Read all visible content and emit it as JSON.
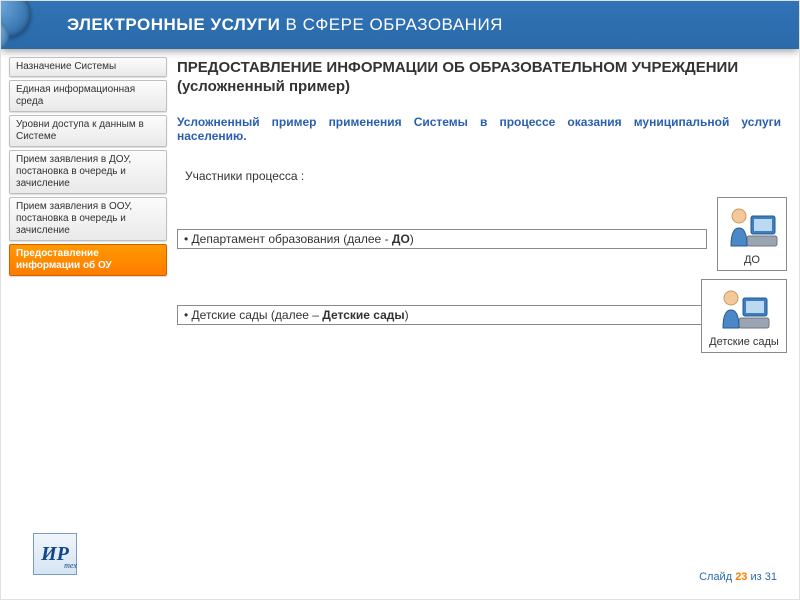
{
  "header": {
    "title_strong": "ЭЛЕКТРОННЫЕ УСЛУГИ",
    "title_rest": " В СФЕРЕ ОБРАЗОВАНИЯ"
  },
  "sidebar": {
    "items": [
      {
        "label": "Назначение Системы"
      },
      {
        "label": "Единая информационная среда"
      },
      {
        "label": "Уровни доступа к данным в Системе"
      },
      {
        "label": "Прием заявления в ДОУ, постановка в очередь и зачисление"
      },
      {
        "label": "Прием заявления в ООУ, постановка в очередь и зачисление"
      },
      {
        "label": "Предоставление информации об ОУ"
      }
    ]
  },
  "main": {
    "title": "ПРЕДОСТАВЛЕНИЕ ИНФОРМАЦИИ ОБ ОБРАЗОВАТЕЛЬНОМ УЧРЕЖДЕНИИ (усложненный пример)",
    "intro": "Усложненный пример применения Системы в процессе оказания муниципальной услуги населению.",
    "participants_label": "Участники процесса :",
    "rows": [
      {
        "text_before": "• Департамент образования (далее - ",
        "bold": "ДО",
        "text_after": ")",
        "actor_label": "ДО"
      },
      {
        "text_before": "• Детские сады (далее – ",
        "bold": "Детские сады",
        "text_after": ")",
        "actor_label": "Детские сады"
      }
    ]
  },
  "logo": {
    "text": "ИР",
    "sub": "тех"
  },
  "footer": {
    "slide_label": "Слайд ",
    "current": "23",
    "of": " из ",
    "total": "31"
  }
}
